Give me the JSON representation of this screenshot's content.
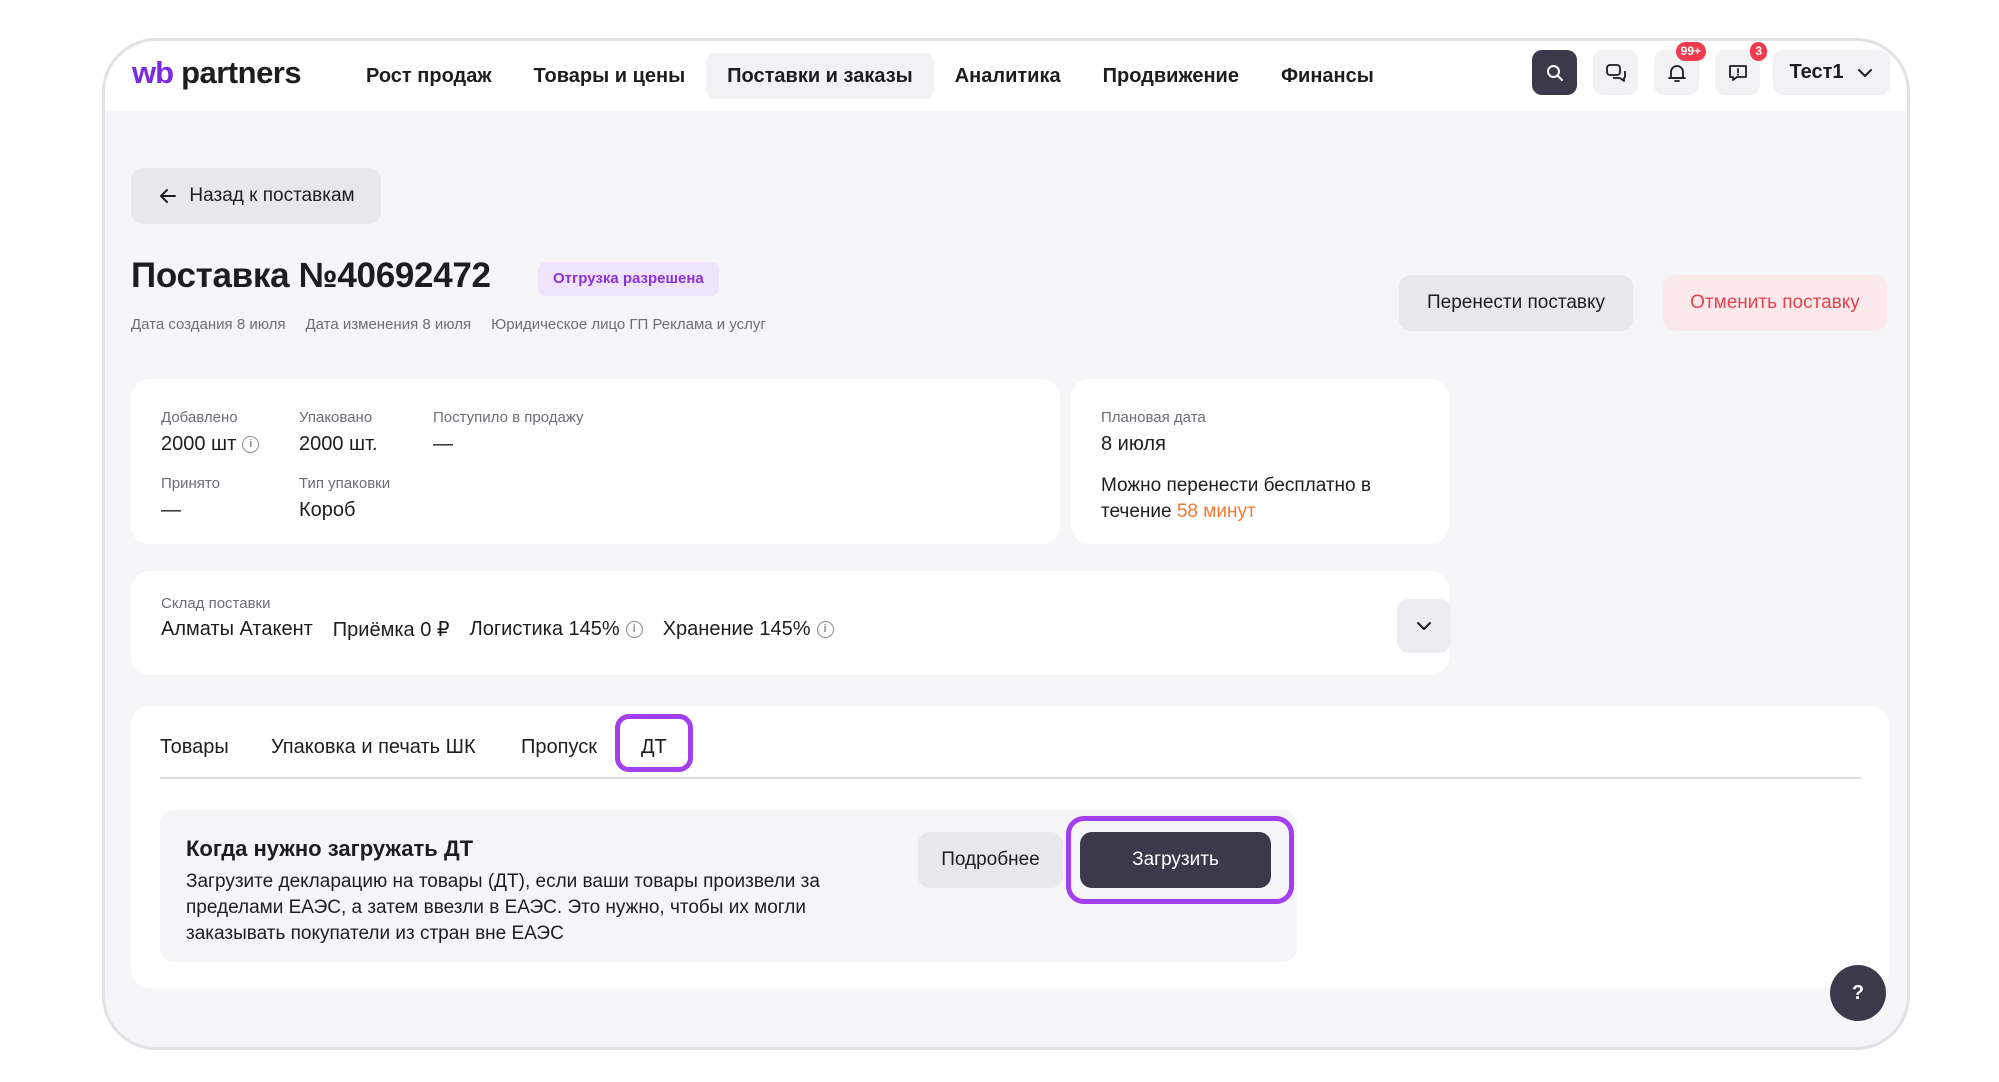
{
  "header": {
    "logo_wb": "wb",
    "logo_partners": "partners",
    "nav": [
      {
        "label": "Рост продаж",
        "active": false
      },
      {
        "label": "Товары и цены",
        "active": false
      },
      {
        "label": "Поставки и заказы",
        "active": true
      },
      {
        "label": "Аналитика",
        "active": false
      },
      {
        "label": "Продвижение",
        "active": false
      },
      {
        "label": "Финансы",
        "active": false
      }
    ],
    "notifications_badge": "99+",
    "messages_badge": "3",
    "user_name": "Тест1",
    "icons": [
      "search-icon",
      "chat-icon",
      "bell-icon",
      "feedback-icon",
      "chevron-down-icon"
    ]
  },
  "back_button": "Назад к поставкам",
  "supply": {
    "title": "Поставка №40692472",
    "status": "Отгрузка разрешена",
    "created": "Дата создания 8 июля",
    "changed": "Дата изменения 8 июля",
    "legal": "Юридическое лицо ГП Реклама и услуг"
  },
  "actions": {
    "reschedule": "Перенести поставку",
    "cancel": "Отменить поставку"
  },
  "stats": {
    "added_label": "Добавлено",
    "added_value": "2000 шт",
    "packed_label": "Упаковано",
    "packed_value": "2000 шт.",
    "on_sale_label": "Поступило в продажу",
    "on_sale_value": "—",
    "accepted_label": "Принято",
    "accepted_value": "—",
    "pack_type_label": "Тип упаковки",
    "pack_type_value": "Короб"
  },
  "plan": {
    "label": "Плановая дата",
    "date": "8 июля",
    "note_line1": "Можно перенести бесплатно в",
    "note_prefix": "течение",
    "note_time": "58 минут"
  },
  "warehouse": {
    "label": "Склад поставки",
    "name": "Алматы Атакент",
    "acceptance": "Приёмка 0 ₽",
    "logistics": "Логистика 145%",
    "storage": "Хранение 145%"
  },
  "tabs": [
    {
      "label": "Товары"
    },
    {
      "label": "Упаковка и печать ШК"
    },
    {
      "label": "Пропуск"
    },
    {
      "label": "ДТ",
      "active": true
    }
  ],
  "dt": {
    "title": "Когда нужно загружать ДТ",
    "text": "Загрузите декларацию на товары (ДТ), если ваши товары произвели за пределами ЕАЭС, а затем ввезли в ЕАЭС. Это нужно, чтобы их могли заказывать покупатели из стран вне ЕАЭС",
    "more": "Подробнее",
    "upload": "Загрузить"
  },
  "help": "?",
  "colors": {
    "accent_purple": "#a43ef1",
    "brand_purple": "#7a2be0",
    "dark_button": "#3c3a4a",
    "cancel_red": "#e4444f",
    "orange": "#f37932",
    "badge_red": "#f23b4f"
  }
}
